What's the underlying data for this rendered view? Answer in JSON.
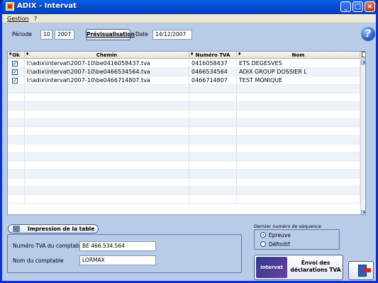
{
  "window": {
    "title": "ADIX - Intervat"
  },
  "menu": [
    "Gestion",
    "?"
  ],
  "filters": {
    "periode_label": "Période",
    "periode_month": "10",
    "periode_year": "2007",
    "preview_label": "Prévisualisation",
    "date_label": "Date",
    "date_value": "14/12/2007"
  },
  "table": {
    "columns": [
      "Ok",
      "Chemin",
      "Numéro TVA",
      "Nom"
    ],
    "rows": [
      {
        "ok": true,
        "chemin": "I:\\adix\\intervat\\2007-10\\be0416058437.tva",
        "tva": "0416058437",
        "nom": "ETS DEGESVES"
      },
      {
        "ok": true,
        "chemin": "I:\\adix\\intervat\\2007-10\\be0466534564.tva",
        "tva": "0466534564",
        "nom": "ADIX GROUP DOSSIER L"
      },
      {
        "ok": true,
        "chemin": "I:\\adix\\intervat\\2007-10\\be0466714807.tva",
        "tva": "0466714807",
        "nom": "TEST MONIQUE"
      }
    ],
    "empty_rows": 14
  },
  "print_button": "Impression de la table",
  "sequence": {
    "title": "Dernier numéro de séquence",
    "options": [
      "Epreuve",
      "Définitif"
    ],
    "selected": "Epreuve"
  },
  "accountant": {
    "tva_label": "Numéro TVA du comptable",
    "tva_value": "BE 466.534.564",
    "name_label": "Nom du comptable",
    "name_value": "LORMAX"
  },
  "send_button": {
    "logo": "Intervat",
    "label_line1": "Envoi des",
    "label_line2": "déclarations TVA"
  },
  "icons": {
    "help": "help-icon",
    "exit": "exit-door-icon",
    "print": "printer-icon"
  }
}
